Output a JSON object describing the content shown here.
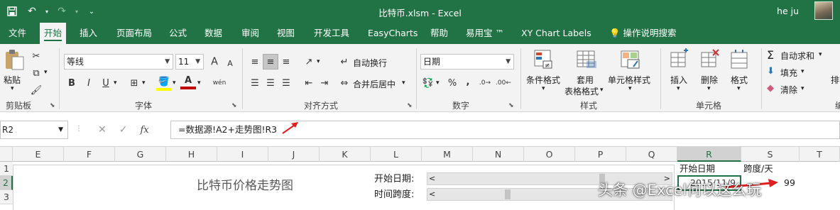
{
  "window": {
    "title": "比特币.xlsm  -  Excel",
    "user": "he ju"
  },
  "tabs": [
    "文件",
    "开始",
    "插入",
    "页面布局",
    "公式",
    "数据",
    "审阅",
    "视图",
    "开发工具",
    "EasyCharts",
    "帮助",
    "易用宝 ™",
    "XY Chart Labels",
    "操作说明搜索"
  ],
  "active_tab": "开始",
  "ribbon": {
    "clipboard": {
      "paste": "粘贴",
      "label": "剪贴板"
    },
    "font": {
      "name": "等线",
      "size": "11",
      "label": "字体",
      "bold": "B",
      "italic": "I",
      "underline": "U",
      "grow": "A",
      "shrink": "A",
      "color": "A",
      "phonetic": "wén"
    },
    "alignment": {
      "wrap": "自动换行",
      "merge": "合并后居中",
      "label": "对齐方式"
    },
    "number": {
      "format": "日期",
      "label": "数字",
      "percent": "%",
      "comma": ","
    },
    "styles": {
      "conditional": "条件格式",
      "table1": "套用",
      "table2": "表格格式",
      "cell_styles": "单元格样式",
      "label": "样式"
    },
    "cells": {
      "insert": "插入",
      "delete": "删除",
      "format": "格式",
      "label": "单元格"
    },
    "editing": {
      "autosum": "自动求和",
      "fill": "填充",
      "clear": "清除",
      "sort": "排"
    }
  },
  "formula_bar": {
    "name_box": "R2",
    "formula": "=数据源!A2+走势图!R3",
    "fx": "fx"
  },
  "columns": [
    "E",
    "F",
    "G",
    "H",
    "I",
    "J",
    "K",
    "L",
    "M",
    "N",
    "O",
    "P",
    "Q",
    "R",
    "S",
    "T"
  ],
  "selected_column": "R",
  "rows": [
    "1",
    "2",
    "3"
  ],
  "selected_row": "2",
  "sheet": {
    "chart_title": "比特币价格走势图",
    "start_label": "开始日期:",
    "span_label": "时间跨度:",
    "scroll_left": "<",
    "scroll_right": ">",
    "start_scroll_value": 0.72,
    "span_scroll_value": 0.3,
    "r1": "开始日期",
    "s1": "跨度/天",
    "r2": "2015/11/9",
    "s2": "99"
  },
  "watermark": "头条 @Excel何以这么玩"
}
